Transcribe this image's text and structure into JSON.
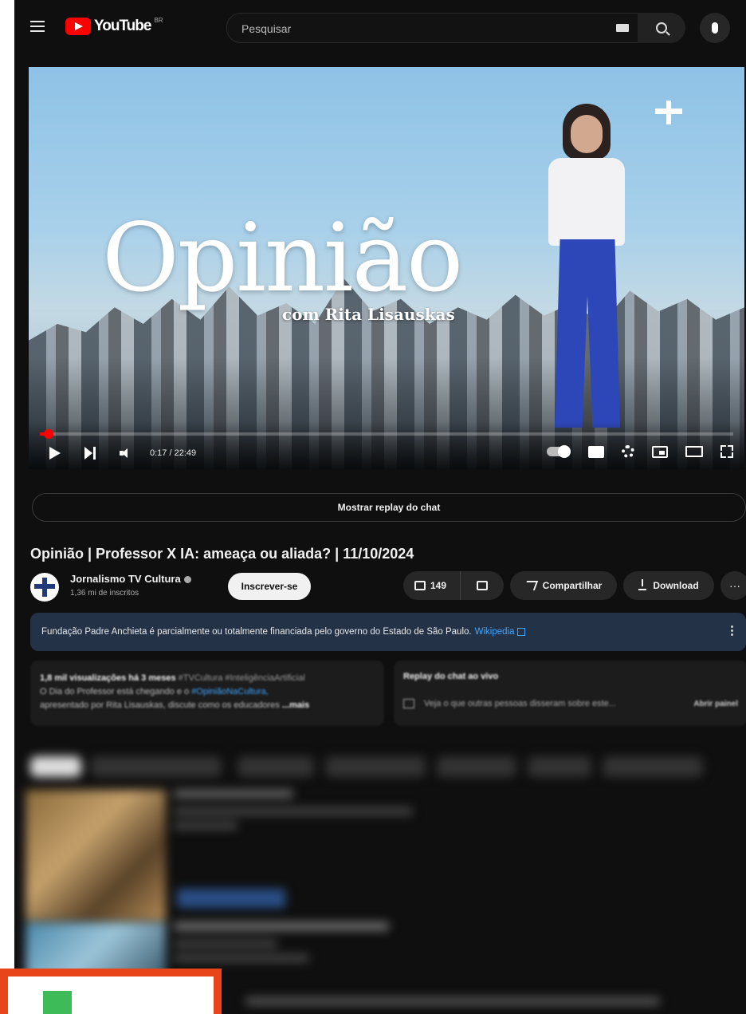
{
  "header": {
    "logo_text": "YouTube",
    "logo_country": "BR",
    "search_placeholder": "Pesquisar"
  },
  "player": {
    "title_big": "Opinião",
    "title_sub": "com Rita Lisauskas",
    "time": "0:17 / 22:49",
    "progress_fraction": 0.0127,
    "progress_color": "#ff0000"
  },
  "chat_replay_label": "Mostrar replay do chat",
  "video": {
    "title": "Opinião | Professor X IA: ameaça ou aliada? | 11/10/2024",
    "channel_name": "Jornalismo TV Cultura",
    "subscribers": "1,36 mi de inscritos",
    "subscribe_label": "Inscrever-se",
    "likes": "149",
    "share_label": "Compartilhar",
    "download_label": "Download",
    "more_label": "···"
  },
  "info_banner": {
    "text": "Fundação Padre Anchieta é parcialmente ou totalmente financiada pelo governo do Estado de São Paulo.",
    "link": "Wikipedia"
  },
  "description": {
    "meta": "1,8 mil visualizações  há 3 meses",
    "tags": "#TVCultura #InteligênciaArtificial",
    "line1": "O Dia do Professor está chegando e o",
    "hashtag": "#OpiniãoNaCultura,",
    "line2": "apresentado por Rita Lisauskas, discute como os educadores",
    "more": "...mais"
  },
  "chat_replay_panel": {
    "title": "Replay do chat ao vivo",
    "text": "Veja o que outras pessoas disseram sobre este...",
    "button": "Abrir painel"
  },
  "colors": {
    "background": "#0f0f0f",
    "accent_red": "#ff0000",
    "link_blue": "#3ea6ff",
    "banner_bg": "#243247",
    "overlay_border": "#e8461a",
    "overlay_green": "#3dbb58"
  }
}
